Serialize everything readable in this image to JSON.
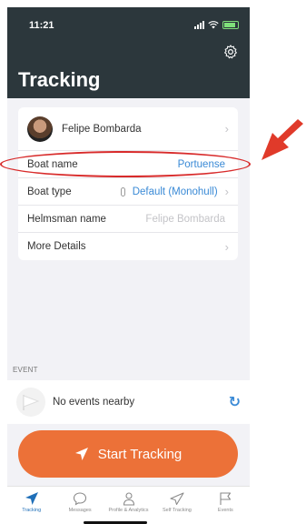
{
  "status": {
    "time": "11:21"
  },
  "header": {
    "title": "Tracking",
    "settings_icon": "gear-icon"
  },
  "profile": {
    "name": "Felipe Bombarda"
  },
  "fields": [
    {
      "label": "Boat name",
      "value": "Portuense",
      "value_style": "link"
    },
    {
      "label": "Boat type",
      "value": "Default (Monohull)",
      "value_style": "link"
    },
    {
      "label": "Helmsman name",
      "value": "Felipe Bombarda",
      "value_style": "muted"
    },
    {
      "label": "More Details",
      "value": "",
      "value_style": "none"
    }
  ],
  "event": {
    "section_label": "EVENT",
    "text": "No events nearby",
    "refresh_icon": "refresh-icon"
  },
  "start_button": {
    "label": "Start Tracking",
    "icon": "navigation-arrow-icon"
  },
  "tabs": [
    {
      "label": "Tracking",
      "icon": "navigation-arrow-icon",
      "active": true
    },
    {
      "label": "Messages",
      "icon": "chat-bubble-icon",
      "active": false
    },
    {
      "label": "Profile & Analytics",
      "icon": "user-icon",
      "active": false
    },
    {
      "label": "Self Tracking",
      "icon": "send-icon",
      "active": false
    },
    {
      "label": "Events",
      "icon": "flag-icon",
      "active": false
    }
  ],
  "colors": {
    "header_bg": "#2c373c",
    "accent": "#ec7138",
    "link": "#3a8ad6",
    "annotation": "#d82b2b"
  }
}
